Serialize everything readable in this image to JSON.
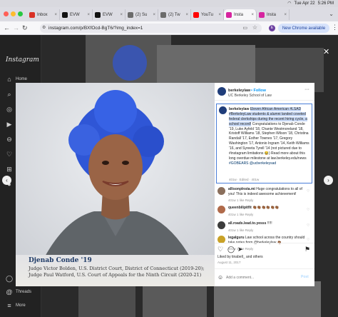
{
  "menubar": {
    "date": "Tue Apr 22",
    "time": "5:26 PM"
  },
  "tabs": [
    {
      "label": "Inbox",
      "color": "#d93025"
    },
    {
      "label": "EVW",
      "color": "#111111"
    },
    {
      "label": "EVW",
      "color": "#111111"
    },
    {
      "label": "(2) Su",
      "color": "#6b6b6b"
    },
    {
      "label": "(2) Tw",
      "color": "#6b6b6b"
    },
    {
      "label": "YouTu",
      "color": "#ff0000"
    },
    {
      "label": "Insta",
      "color": "#d6249f"
    },
    {
      "label": "Insta",
      "color": "#d6249f"
    }
  ],
  "omnibox": {
    "url": "instagram.com/p/BXfOcd-BgT6/?img_index=1"
  },
  "profile": {
    "initial": "E"
  },
  "chrome_button": "New Chrome available",
  "ig": {
    "logo": "Instagram",
    "nav": [
      {
        "label": "Home",
        "icon": "⌂"
      },
      {
        "label": "",
        "icon": "⌕"
      },
      {
        "label": "",
        "icon": "◎"
      },
      {
        "label": "",
        "icon": "▶"
      },
      {
        "label": "",
        "icon": "⊖"
      },
      {
        "label": "",
        "icon": "♡"
      },
      {
        "label": "",
        "icon": "⊞"
      },
      {
        "label": "",
        "icon": "●"
      }
    ],
    "bottom_nav": [
      {
        "label": "",
        "icon": "◯"
      },
      {
        "label": "Threads",
        "icon": "@"
      },
      {
        "label": "More",
        "icon": "≡"
      }
    ]
  },
  "post": {
    "username": "berkeleylaw",
    "follow": "• Follow",
    "subtitle": "UC Berkeley School of Law",
    "more_icon": "···",
    "image_caption": {
      "name": "Djenab Conde '19",
      "line1": "Judge Victor Bolden, U.S. District Court, District of Connecticut (2019-20);",
      "line2": "Judge Paul Watford, U.S. Court of Appeals for the Ninth Circuit (2020-21)"
    },
    "caption": {
      "user": "berkeleylaw",
      "highlighted": "Eleven African American #LSAD #BerkeleyLaw students & alumni landed coveted federal clerkships during the recent hiring cycle, a school record!",
      "rest": " Congratulations to Djenab Conde '19, Luke Ayfeld '18, Chante Westmoreland '18, Kristoff Williams '18, Stephen Wilson '18, Christina Randall '17, Esther Townes '17, Gregory Washington '17, Antonio Ingram '14, Keith Williams '16, and Syreeta Tyrell '14 (not pictured due to #instagram limitations 😂) Read more about this long overdue milestone at law.berkeley.edu/news",
      "tags": "#GOBEARS @ucberkeleysad",
      "time": "401w · Edited · 401w"
    },
    "comments": [
      {
        "user": "allisonplnsta.mi",
        "text": "Huge congratulations to all of you! This is indeed awesome achievement!",
        "meta": "401w   1 like   Reply",
        "color": "#8a6f5c"
      },
      {
        "user": "queenbilipitfit",
        "text": "👏🏾👏🏾👏🏾👏🏾👏🏾👏🏾",
        "meta": "401w   1 like   Reply",
        "color": "#b06a4a"
      },
      {
        "user": "all.roads.lead.to.yesss",
        "text": "!!!!!",
        "meta": "401w   1 like   Reply",
        "color": "#3c3c3c"
      },
      {
        "user": "legalguru",
        "text": "Law school across the country should take notes from @berkeleylaw 👏🏾",
        "meta": "401w   1 like   Reply",
        "color": "#c9a227"
      }
    ],
    "liked_by": "Liked by tinabell_ and others",
    "date": "August 11, 2017",
    "add_comment_placeholder": "Add a comment...",
    "post_label": "Post"
  },
  "colors": {
    "accent": "#0095f6",
    "hair": "#2f56d6",
    "highlight": "#c7d8f5"
  }
}
